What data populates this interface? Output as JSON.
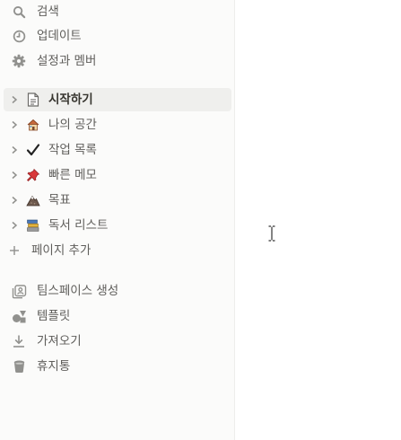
{
  "nav": {
    "search": "검색",
    "updates": "업데이트",
    "settings": "설정과 멤버"
  },
  "pages": [
    {
      "label": "시작하기",
      "icon": "document-icon",
      "active": true
    },
    {
      "label": "나의 공간",
      "icon": "house-icon",
      "active": false
    },
    {
      "label": "작업 목록",
      "icon": "checkmark-icon",
      "active": false
    },
    {
      "label": "빠른 메모",
      "icon": "pushpin-icon",
      "active": false
    },
    {
      "label": "목표",
      "icon": "mountain-icon",
      "active": false
    },
    {
      "label": "독서 리스트",
      "icon": "books-icon",
      "active": false
    }
  ],
  "add_page": "페이지 추가",
  "bottom": {
    "workspace": "팀스페이스 생성",
    "templates": "템플릿",
    "import": "가져오기",
    "trash": "휴지통"
  },
  "colors": {
    "sidebar_bg": "#fbfbfa",
    "active_bg": "#efefed",
    "icon_gray": "#91918e"
  }
}
